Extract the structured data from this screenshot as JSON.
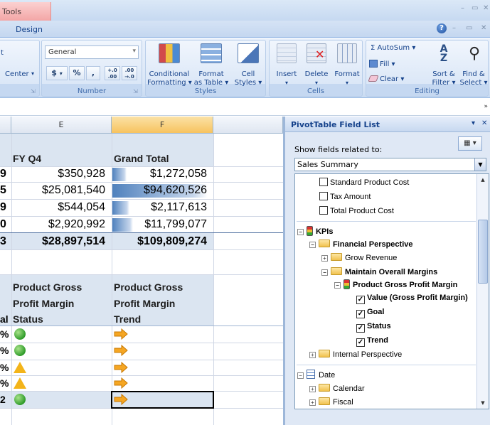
{
  "titlebar": {
    "context_tab_label": "Tools",
    "minimize": "–",
    "restore": "▭",
    "close": "✕"
  },
  "tabs": {
    "design": "Design",
    "help": "?",
    "minimize": "–",
    "restore": "▭",
    "close": "✕"
  },
  "ribbon": {
    "alignment": {
      "merge_center": "Center",
      "merge_center_prefix": "t",
      "dialog": "⇲"
    },
    "number": {
      "label": "Number",
      "format_value": "General",
      "currency": "$",
      "percent": "%",
      "comma": ",",
      "inc_decimal": "+.0 .00",
      "dec_decimal": ".00 →.0",
      "dialog": "⇲"
    },
    "styles": {
      "label": "Styles",
      "conditional_formatting": [
        "Conditional",
        "Formatting ▾"
      ],
      "format_as_table": [
        "Format",
        "as Table ▾"
      ],
      "cell_styles": [
        "Cell",
        "Styles ▾"
      ]
    },
    "cells": {
      "label": "Cells",
      "insert": "Insert",
      "delete": "Delete",
      "format": "Format",
      "dropdown": "▾"
    },
    "editing": {
      "label": "Editing",
      "autosum": "Σ AutoSum ▾",
      "fill": "Fill ▾",
      "clear": "Clear ▾",
      "sort_filter": [
        "Sort &",
        "Filter ▾"
      ],
      "find_select": [
        "Find &",
        "Select ▾"
      ]
    }
  },
  "formula_bar": {
    "expand": "»"
  },
  "sheet": {
    "columns": [
      "E",
      "F"
    ],
    "headers": {
      "fy_q4": "FY Q4",
      "grand_total": "Grand Total"
    },
    "rows": [
      {
        "frag": "9",
        "fy_q4": "$350,928",
        "grand_total": "$1,272,058",
        "bar": 0.15
      },
      {
        "frag": "5",
        "fy_q4": "$25,081,540",
        "grand_total": "$94,620,526",
        "bar": 1.0
      },
      {
        "frag": "9",
        "fy_q4": "$544,054",
        "grand_total": "$2,117,613",
        "bar": 0.18
      },
      {
        "frag": "0",
        "fy_q4": "$2,920,992",
        "grand_total": "$11,799,077",
        "bar": 0.22
      }
    ],
    "total": {
      "frag": "3",
      "fy_q4": "$28,897,514",
      "grand_total": "$109,809,274"
    },
    "kpi_headers": {
      "status": [
        "Product Gross",
        "Profit Margin",
        "Status"
      ],
      "trend": [
        "Product Gross",
        "Profit Margin",
        "Trend"
      ],
      "frag": "al"
    },
    "kpi_rows": [
      {
        "frag": "%",
        "status": "green",
        "trend": "right"
      },
      {
        "frag": "%",
        "status": "green",
        "trend": "right"
      },
      {
        "frag": "%",
        "status": "yellow",
        "trend": "right"
      },
      {
        "frag": "%",
        "status": "yellow",
        "trend": "right"
      },
      {
        "frag": "2",
        "status": "green",
        "trend": "right"
      }
    ]
  },
  "pivot": {
    "title": "PivotTable Field List",
    "title_dropdown": "▾",
    "title_close": "✕",
    "show_fields_label": "Show fields related to:",
    "layout_button": "▦ ▾",
    "related_select": "Sales Summary",
    "select_arrow": "▼",
    "scroll_up": "▲",
    "scroll_down": "▼",
    "expand_plus": "+",
    "expand_minus": "−",
    "check_mark": "✓",
    "tree": {
      "standard_product_cost": "Standard Product Cost",
      "tax_amount": "Tax Amount",
      "total_product_cost": "Total Product Cost",
      "kpis": "KPIs",
      "financial_perspective": "Financial Perspective",
      "grow_revenue": "Grow Revenue",
      "maintain_margins": "Maintain Overall Margins",
      "gross_profit_margin": "Product Gross Profit Margin",
      "value": "Value (Gross Profit Margin)",
      "goal": "Goal",
      "status": "Status",
      "trend": "Trend",
      "internal_perspective": "Internal Perspective",
      "date": "Date",
      "calendar": "Calendar",
      "fiscal": "Fiscal"
    }
  },
  "colors": {
    "ribbon_text": "#15428b",
    "databar": "#4f81bd",
    "status_green": "#2f9c2a",
    "status_yellow": "#f3b41a",
    "trend_orange": "#f5a623"
  }
}
